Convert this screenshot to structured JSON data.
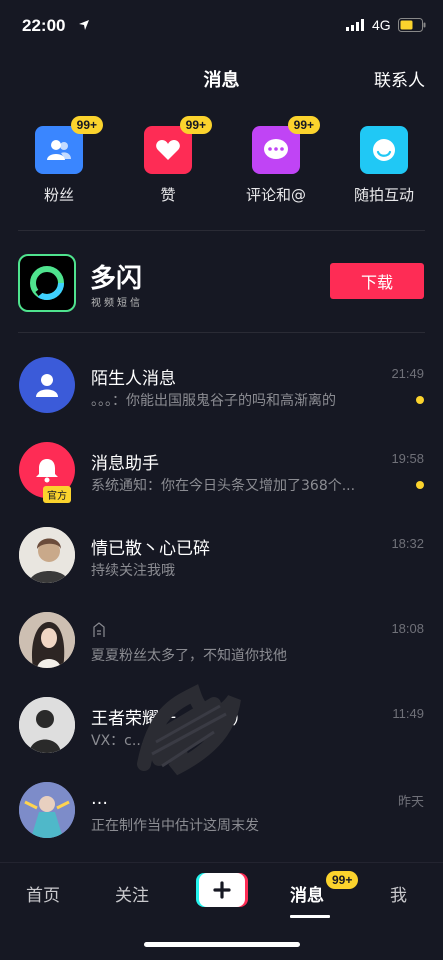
{
  "status_bar": {
    "time": "22:00",
    "network": "4G"
  },
  "header": {
    "title": "消息",
    "contacts": "联系人"
  },
  "quick_actions": [
    {
      "label": "粉丝",
      "badge": "99+",
      "icon": "fans-icon",
      "color": "#3a86ff"
    },
    {
      "label": "赞",
      "badge": "99+",
      "icon": "heart-icon",
      "color": "#fe2c55"
    },
    {
      "label": "评论和@",
      "badge": "99+",
      "icon": "comment-icon",
      "color": "#c044f5"
    },
    {
      "label": "随拍互动",
      "badge": "",
      "icon": "camera-icon",
      "color": "#20c8f5"
    }
  ],
  "banner": {
    "name": "多闪",
    "subtitle": "视频短信",
    "download": "下载"
  },
  "messages": [
    {
      "name": "陌生人消息",
      "preview": "。。。：你能出国服鬼谷子的吗和高渐离的",
      "time": "21:49",
      "unread": true
    },
    {
      "name": "消息助手",
      "preview": "系统通知：你在今日头条又增加了368个...",
      "time": "19:58",
      "unread": true,
      "tag": "官方"
    },
    {
      "name": "情已散丶心已碎",
      "preview": "持续关注我哦",
      "time": "18:32",
      "unread": false
    },
    {
      "name": "",
      "preview": "夏夏粉丝太多了，不知道你找他",
      "time": "18:08",
      "unread": false
    },
    {
      "name": "王者荣耀一 （木兰）",
      "preview": "VX：c...",
      "time": "11:49",
      "unread": false
    },
    {
      "name": "…",
      "preview": "正在制作当中估计这周末发",
      "time": "昨天",
      "unread": false
    }
  ],
  "tabs": [
    {
      "label": "首页"
    },
    {
      "label": "关注"
    },
    {
      "label": "消息",
      "badge": "99+"
    },
    {
      "label": "我"
    }
  ]
}
